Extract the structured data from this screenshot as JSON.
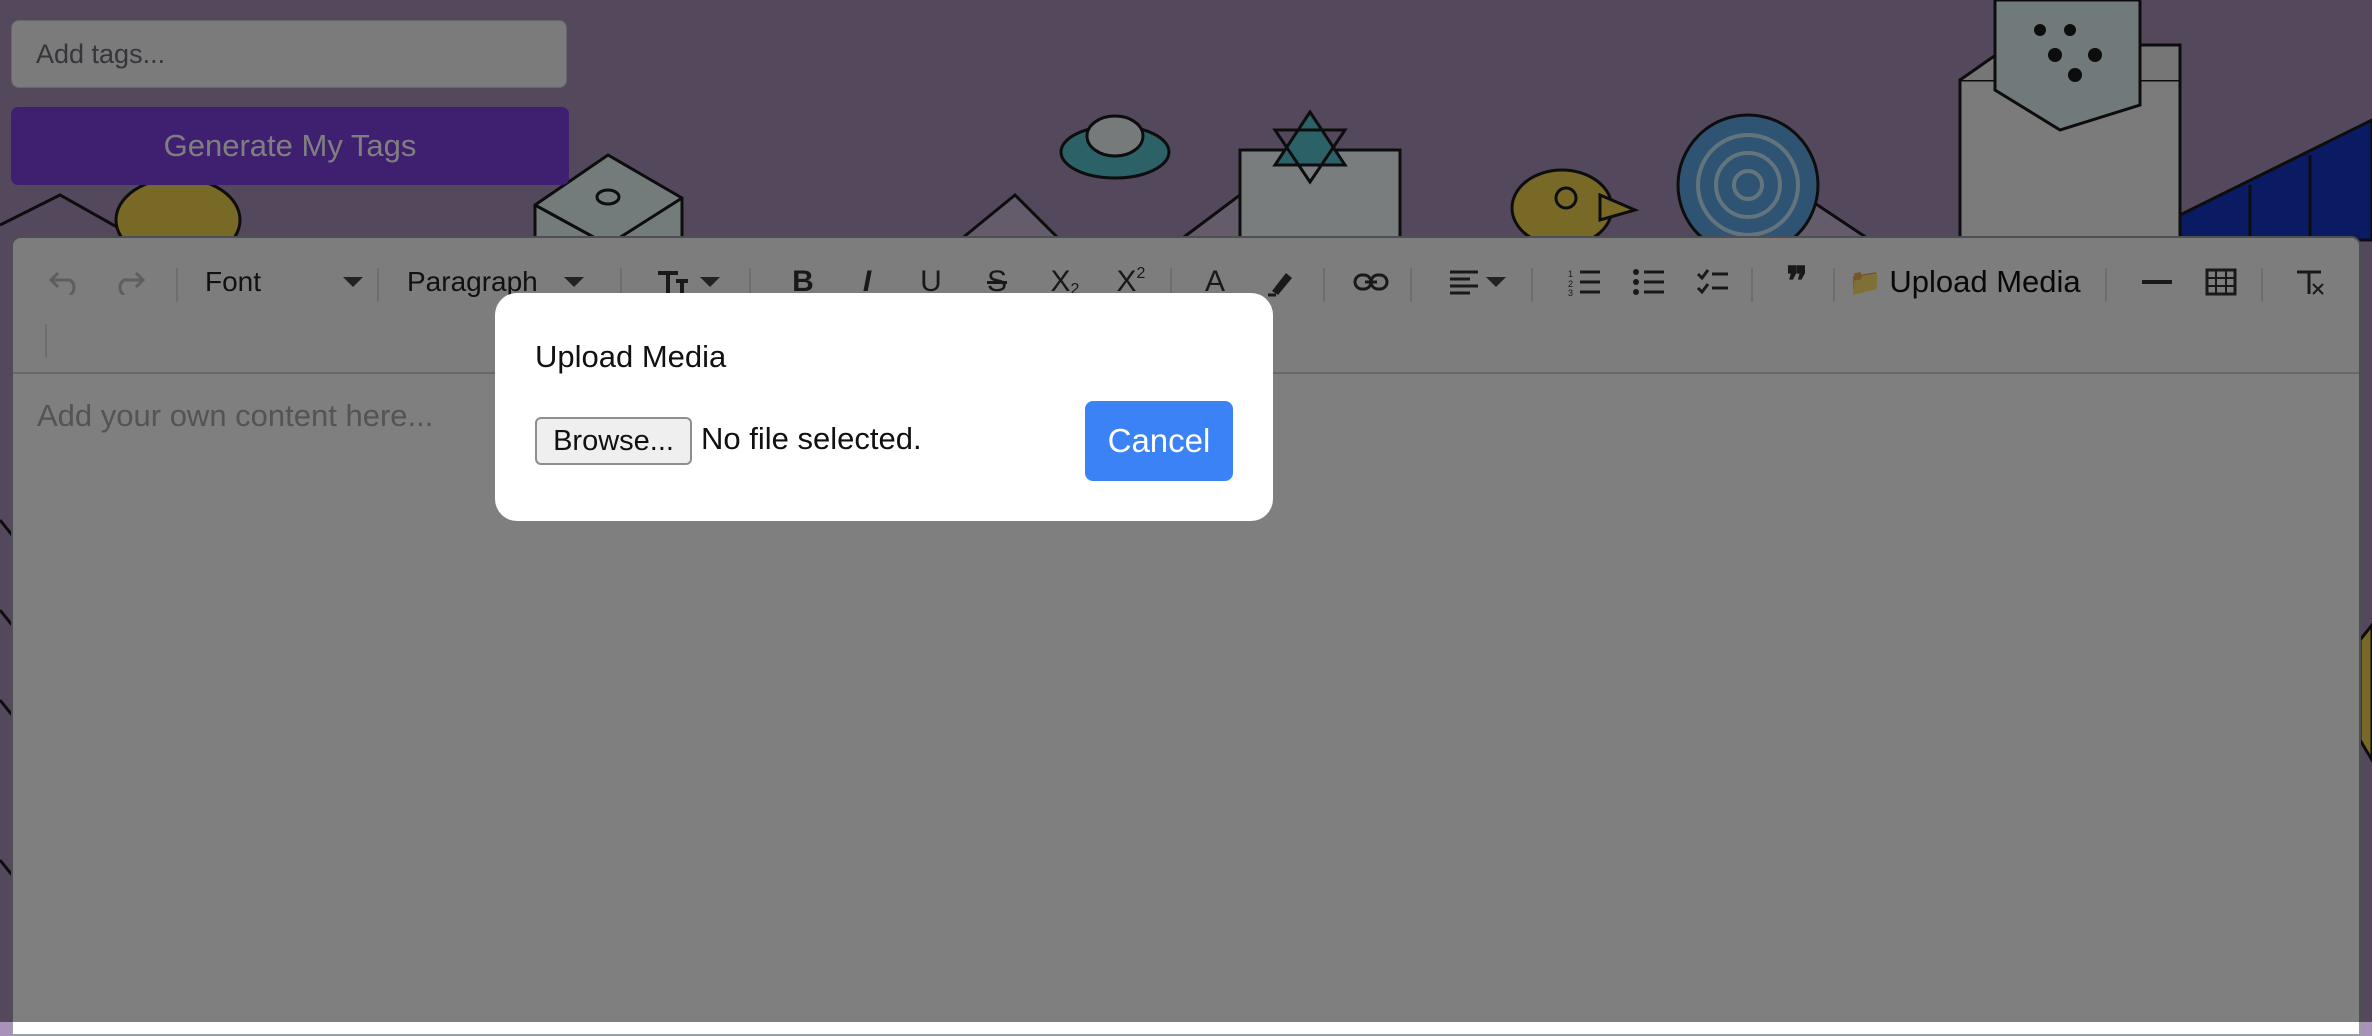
{
  "tags": {
    "placeholder": "Add tags...",
    "generate_label": "Generate My Tags"
  },
  "editor": {
    "toolbar": {
      "font_label": "Font",
      "paragraph_label": "Paragraph",
      "upload_media_label": "Upload Media",
      "upload_media_icon": "📁"
    },
    "placeholder": "Add your own content here..."
  },
  "modal": {
    "title": "Upload Media",
    "browse_label": "Browse...",
    "file_status": "No file selected.",
    "cancel_label": "Cancel"
  },
  "colors": {
    "background": "#a992b8",
    "primary_button": "#7c3fe0",
    "cancel_button": "#3b82f6",
    "overlay": "rgba(0,0,0,0.5)"
  }
}
